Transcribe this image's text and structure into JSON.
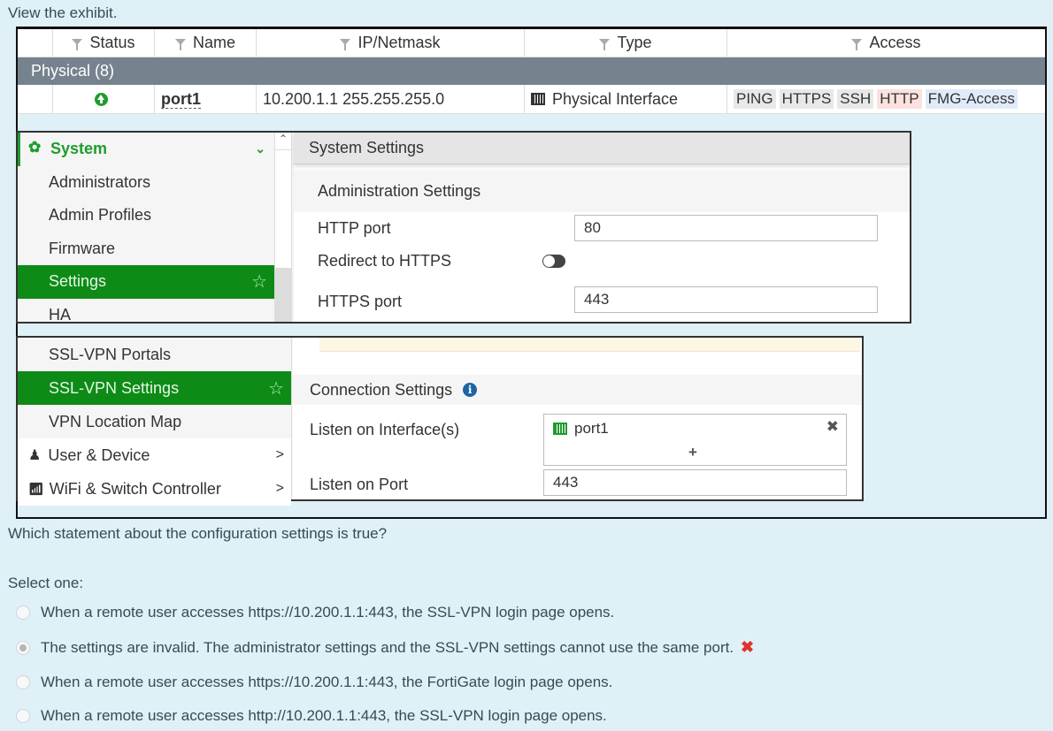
{
  "intro_text": "View the exhibit.",
  "interfaces_table": {
    "columns": [
      "",
      "Status",
      "Name",
      "IP/Netmask",
      "Type",
      "Access"
    ],
    "group_label": "Physical (8)",
    "rows": [
      {
        "status": "up",
        "name": "port1",
        "ip_netmask": "10.200.1.1 255.255.255.0",
        "type": "Physical Interface",
        "access": [
          {
            "label": "PING",
            "color": "#e8e8e8"
          },
          {
            "label": "HTTPS",
            "color": "#e8e8e8"
          },
          {
            "label": "SSH",
            "color": "#e8e8e8"
          },
          {
            "label": "HTTP",
            "color": "#fbe1df"
          },
          {
            "label": "FMG-Access",
            "color": "#e0ebfa"
          }
        ]
      }
    ]
  },
  "system_panel": {
    "nav": {
      "group_label": "System",
      "items": [
        "Administrators",
        "Admin Profiles",
        "Firmware",
        "Settings",
        "HA"
      ],
      "active_item": "Settings"
    },
    "title": "System Settings",
    "section": "Administration Settings",
    "fields": {
      "http_port_label": "HTTP port",
      "http_port_value": "80",
      "redirect_label": "Redirect to HTTPS",
      "redirect_enabled": false,
      "https_port_label": "HTTPS port",
      "https_port_value": "443"
    }
  },
  "vpn_panel": {
    "nav": {
      "items": [
        "SSL-VPN Portals",
        "SSL-VPN Settings",
        "VPN Location Map"
      ],
      "active_item": "SSL-VPN Settings",
      "top_level": [
        "User & Device",
        "WiFi & Switch Controller"
      ]
    },
    "section": "Connection Settings",
    "fields": {
      "listen_interface_label": "Listen on Interface(s)",
      "listen_interface_value": "port1",
      "add_symbol": "+",
      "remove_symbol": "✖",
      "listen_port_label": "Listen on Port",
      "listen_port_value": "443"
    }
  },
  "quiz": {
    "question": "Which statement about the configuration settings is true?",
    "prompt": "Select one:",
    "options": [
      "When a remote user accesses https://10.200.1.1:443, the SSL-VPN login page opens.",
      "The settings are invalid. The administrator settings and the SSL-VPN settings cannot use the same port.",
      "When a remote user accesses https://10.200.1.1:443, the FortiGate login page opens.",
      "When a remote user accesses http://10.200.1.1:443, the SSL-VPN login page opens."
    ],
    "selected_index": 1,
    "selected_result": "✖",
    "result_color": "#e0322c"
  }
}
